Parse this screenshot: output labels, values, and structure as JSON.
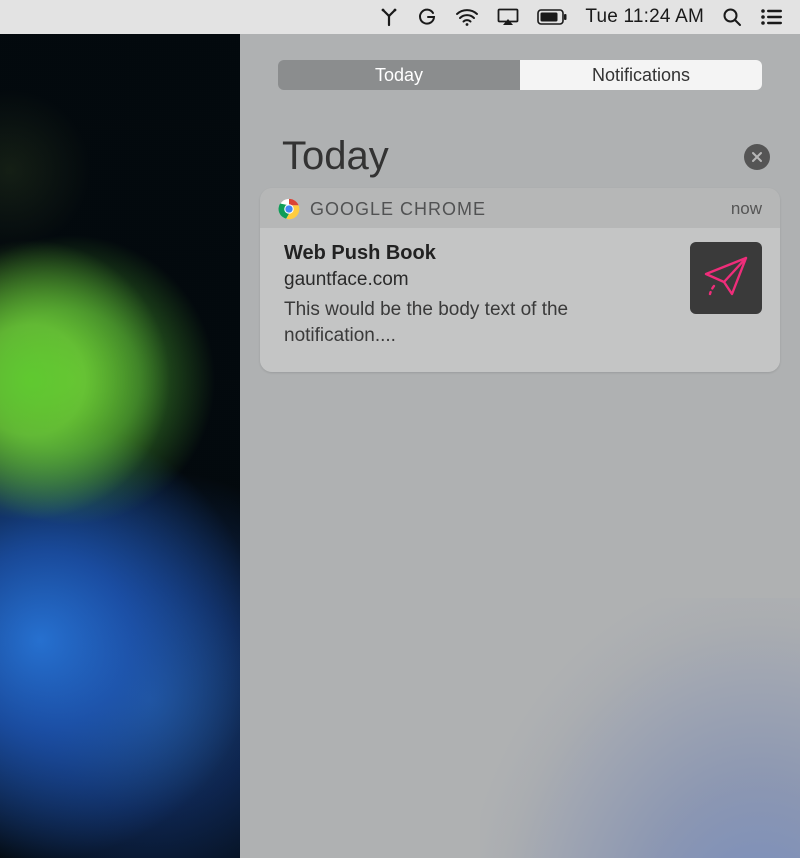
{
  "menubar": {
    "datetime": "Tue 11:24 AM"
  },
  "nc": {
    "tabs": {
      "today": "Today",
      "notifications": "Notifications"
    },
    "heading": "Today"
  },
  "notification": {
    "app": "GOOGLE CHROME",
    "timestamp": "now",
    "title": "Web Push Book",
    "domain": "gauntface.com",
    "body": "This would be the body text of the notification...."
  }
}
